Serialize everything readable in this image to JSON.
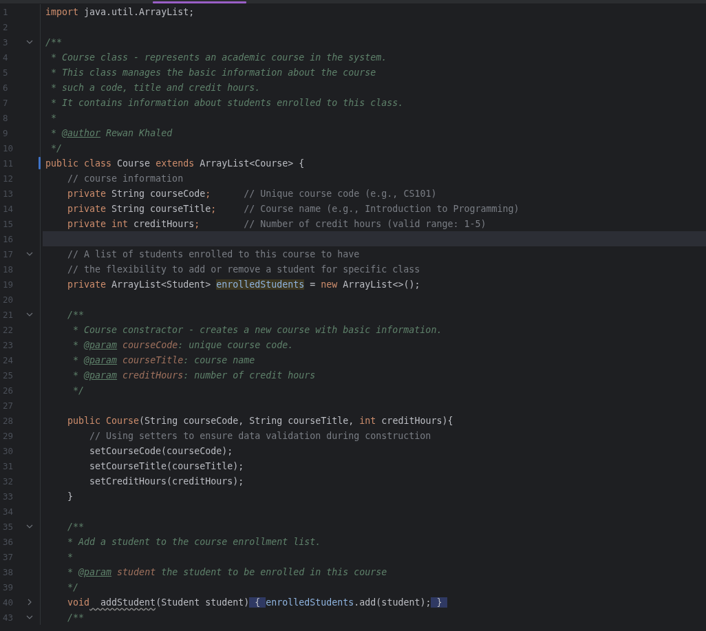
{
  "editor": {
    "lines": [
      {
        "number": "1",
        "current": false,
        "changed": false,
        "tokens": [
          {
            "t": "import",
            "kind": "kw"
          },
          {
            "t": " java.util.ArrayList;",
            "kind": "plain"
          }
        ]
      },
      {
        "number": "2",
        "current": false,
        "changed": false
      },
      {
        "number": "3",
        "current": false,
        "changed": false,
        "collapsed": false,
        "tokens": [
          {
            "t": "/**",
            "kind": "doc"
          }
        ]
      },
      {
        "number": "4",
        "current": false,
        "changed": false,
        "tokens": [
          {
            "t": " * Course class - represents an academic course in the system.",
            "kind": "doc"
          }
        ]
      },
      {
        "number": "5",
        "current": false,
        "changed": false,
        "tokens": [
          {
            "t": " * This class manages the basic information about the course",
            "kind": "doc"
          }
        ]
      },
      {
        "number": "6",
        "current": false,
        "changed": false,
        "tokens": [
          {
            "t": " * such a code, title and credit hours.",
            "kind": "doc"
          }
        ]
      },
      {
        "number": "7",
        "current": false,
        "changed": false,
        "tokens": [
          {
            "t": " * It contains information about students enrolled to this class.",
            "kind": "doc"
          }
        ]
      },
      {
        "number": "8",
        "current": false,
        "changed": false,
        "tokens": [
          {
            "t": " *",
            "kind": "doc"
          }
        ]
      },
      {
        "number": "9",
        "current": false,
        "changed": false,
        "tokens": [
          {
            "t": " * ",
            "kind": "doc"
          },
          {
            "t": "@author",
            "kind": "doctag"
          },
          {
            "t": " Rewan Khaled",
            "kind": "doc"
          }
        ]
      },
      {
        "number": "10",
        "current": false,
        "changed": false,
        "tokens": [
          {
            "t": " */",
            "kind": "doc"
          }
        ]
      },
      {
        "number": "11",
        "current": false,
        "changed": true,
        "tokens": [
          {
            "t": "public class",
            "kind": "kw"
          },
          {
            "t": " Course ",
            "kind": "plain"
          },
          {
            "t": "extends",
            "kind": "kw"
          },
          {
            "t": " ArrayList<Course> {",
            "kind": "plain"
          }
        ]
      },
      {
        "number": "12",
        "current": false,
        "changed": false,
        "tokens": [
          {
            "t": "    // course information",
            "kind": "comment"
          }
        ]
      },
      {
        "number": "13",
        "current": false,
        "changed": false,
        "tokens": [
          {
            "t": "    private",
            "kind": "kw"
          },
          {
            "t": " String courseCode",
            "kind": "plain"
          },
          {
            "t": ";",
            "kind": "kw"
          },
          {
            "t": "      // Unique course code (e.g., CS101)",
            "kind": "comment"
          }
        ]
      },
      {
        "number": "14",
        "current": false,
        "changed": false,
        "tokens": [
          {
            "t": "    private",
            "kind": "kw"
          },
          {
            "t": " String courseTitle",
            "kind": "plain"
          },
          {
            "t": ";",
            "kind": "kw"
          },
          {
            "t": "     // Course name (e.g., Introduction to Programming)",
            "kind": "comment"
          }
        ]
      },
      {
        "number": "15",
        "current": false,
        "changed": false,
        "tokens": [
          {
            "t": "    private int",
            "kind": "kw"
          },
          {
            "t": " creditHours",
            "kind": "plain"
          },
          {
            "t": ";",
            "kind": "kw"
          },
          {
            "t": "        // Number of credit hours (valid range: 1-5)",
            "kind": "comment"
          }
        ]
      },
      {
        "number": "16",
        "current": true,
        "changed": false
      },
      {
        "number": "17",
        "current": false,
        "changed": false,
        "collapsed": false,
        "tokens": [
          {
            "t": "    // A list of students enrolled to this course to have",
            "kind": "comment"
          }
        ]
      },
      {
        "number": "18",
        "current": false,
        "changed": false,
        "tokens": [
          {
            "t": "    // the flexibility to add or remove a student for specific class",
            "kind": "comment"
          }
        ]
      },
      {
        "number": "19",
        "current": false,
        "changed": false,
        "tokens": [
          {
            "t": "    private",
            "kind": "kw"
          },
          {
            "t": " ArrayList<Student> ",
            "kind": "plain"
          },
          {
            "t": "enrolledStudents",
            "kind": "fieldhl"
          },
          {
            "t": " = ",
            "kind": "plain"
          },
          {
            "t": "new",
            "kind": "kw"
          },
          {
            "t": " ArrayList<>();",
            "kind": "plain"
          }
        ]
      },
      {
        "number": "20",
        "current": false,
        "changed": false
      },
      {
        "number": "21",
        "current": false,
        "changed": false,
        "collapsed": false,
        "tokens": [
          {
            "t": "    /**",
            "kind": "doc"
          }
        ]
      },
      {
        "number": "22",
        "current": false,
        "changed": false,
        "tokens": [
          {
            "t": "     * Course constractor - creates a new course with basic information.",
            "kind": "doc"
          }
        ]
      },
      {
        "number": "23",
        "current": false,
        "changed": false,
        "tokens": [
          {
            "t": "     * ",
            "kind": "doc"
          },
          {
            "t": "@param",
            "kind": "doctag"
          },
          {
            "t": " courseCode",
            "kind": "docparam"
          },
          {
            "t": ": unique course code.",
            "kind": "doc"
          }
        ]
      },
      {
        "number": "24",
        "current": false,
        "changed": false,
        "tokens": [
          {
            "t": "     * ",
            "kind": "doc"
          },
          {
            "t": "@param",
            "kind": "doctag"
          },
          {
            "t": " courseTitle",
            "kind": "docparam"
          },
          {
            "t": ": course name",
            "kind": "doc"
          }
        ]
      },
      {
        "number": "25",
        "current": false,
        "changed": false,
        "tokens": [
          {
            "t": "     * ",
            "kind": "doc"
          },
          {
            "t": "@param",
            "kind": "doctag"
          },
          {
            "t": " creditHours",
            "kind": "docparam"
          },
          {
            "t": ": number of credit hours",
            "kind": "doc"
          }
        ]
      },
      {
        "number": "26",
        "current": false,
        "changed": false,
        "tokens": [
          {
            "t": "     */",
            "kind": "doc"
          }
        ]
      },
      {
        "number": "27",
        "current": false,
        "changed": false
      },
      {
        "number": "28",
        "current": false,
        "changed": false,
        "tokens": [
          {
            "t": "    public",
            "kind": "kw"
          },
          {
            "t": " Course",
            "kind": "ctor"
          },
          {
            "t": "(String courseCode, String courseTitle, ",
            "kind": "plain"
          },
          {
            "t": "int",
            "kind": "kw"
          },
          {
            "t": " creditHours){",
            "kind": "plain"
          }
        ]
      },
      {
        "number": "29",
        "current": false,
        "changed": false,
        "tokens": [
          {
            "t": "        // Using setters to ensure data validation during construction",
            "kind": "comment"
          }
        ]
      },
      {
        "number": "30",
        "current": false,
        "changed": false,
        "tokens": [
          {
            "t": "        setCourseCode(courseCode);",
            "kind": "plain"
          }
        ]
      },
      {
        "number": "31",
        "current": false,
        "changed": false,
        "tokens": [
          {
            "t": "        setCourseTitle(courseTitle);",
            "kind": "plain"
          }
        ]
      },
      {
        "number": "32",
        "current": false,
        "changed": false,
        "tokens": [
          {
            "t": "        setCreditHours(creditHours);",
            "kind": "plain"
          }
        ]
      },
      {
        "number": "33",
        "current": false,
        "changed": false,
        "tokens": [
          {
            "t": "    }",
            "kind": "plain"
          }
        ]
      },
      {
        "number": "34",
        "current": false,
        "changed": false
      },
      {
        "number": "35",
        "current": false,
        "changed": false,
        "collapsed": false,
        "tokens": [
          {
            "t": "    /**",
            "kind": "doc"
          }
        ]
      },
      {
        "number": "36",
        "current": false,
        "changed": false,
        "tokens": [
          {
            "t": "    * Add a student to the course enrollment list.",
            "kind": "doc"
          }
        ]
      },
      {
        "number": "37",
        "current": false,
        "changed": false,
        "tokens": [
          {
            "t": "    *",
            "kind": "doc"
          }
        ]
      },
      {
        "number": "38",
        "current": false,
        "changed": false,
        "tokens": [
          {
            "t": "    * ",
            "kind": "doc"
          },
          {
            "t": "@param",
            "kind": "doctag"
          },
          {
            "t": " student",
            "kind": "docparam"
          },
          {
            "t": " the student to be enrolled in this course",
            "kind": "doc"
          }
        ]
      },
      {
        "number": "39",
        "current": false,
        "changed": false,
        "tokens": [
          {
            "t": "    */",
            "kind": "doc"
          }
        ]
      },
      {
        "number": "40",
        "current": false,
        "changed": false,
        "collapsed": true,
        "tokens": [
          {
            "t": "    void",
            "kind": "kw"
          },
          {
            "t": "  addStudent",
            "kind": "unused"
          },
          {
            "t": "(Student student)",
            "kind": "plain"
          },
          {
            "t": " { ",
            "kind": "foldbrace"
          },
          {
            "t": "enrolledStudents",
            "kind": "field"
          },
          {
            "t": ".add(student);",
            "kind": "plain"
          },
          {
            "t": " } ",
            "kind": "foldbrace"
          }
        ]
      },
      {
        "number": "43",
        "current": false,
        "changed": false,
        "collapsed": false,
        "tokens": [
          {
            "t": "    /**",
            "kind": "doc"
          }
        ]
      }
    ]
  }
}
